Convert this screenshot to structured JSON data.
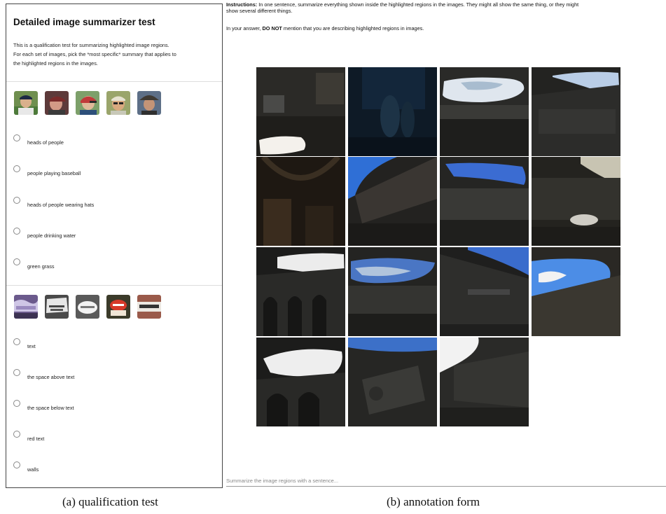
{
  "qualification": {
    "title": "Detailed image summarizer test",
    "description_lines": [
      "This is a qualification test for summarizing highlighted image regions.",
      "For each set of images, pick the *most specific* summary that applies to",
      "the highlighted regions in the images."
    ],
    "set1": {
      "thumbnail_icons": [
        "baseball-player-head",
        "man-cap-head",
        "kid-helmet-head",
        "man-sunglasses-head",
        "man-hat-head"
      ],
      "options": [
        "heads of people",
        "people playing baseball",
        "heads of people wearing hats",
        "people drinking water",
        "green grass"
      ]
    },
    "set2": {
      "thumbnail_icons": [
        "purple-sign-text",
        "cook-sign-text",
        "white-sign-text",
        "red-sign-text",
        "black-mac-sign-text"
      ],
      "options": [
        "text",
        "the space above text",
        "the space below text",
        "red text",
        "walls"
      ]
    }
  },
  "annotation": {
    "instructions_label": "Instructions:",
    "instructions_line1": " In one sentence, summarize everything shown inside the highlighted regions in the images. They might all show the same thing, or they might",
    "instructions_line2": "show several different things.",
    "note_prefix": "In your answer, ",
    "note_emphasis": "DO NOT",
    "note_suffix": " mention that you are describing highlighted regions in images.",
    "input_placeholder": "Summarize the image regions with a sentence..."
  },
  "captions": {
    "left": "(a) qualification test",
    "right": "(b) annotation form"
  }
}
